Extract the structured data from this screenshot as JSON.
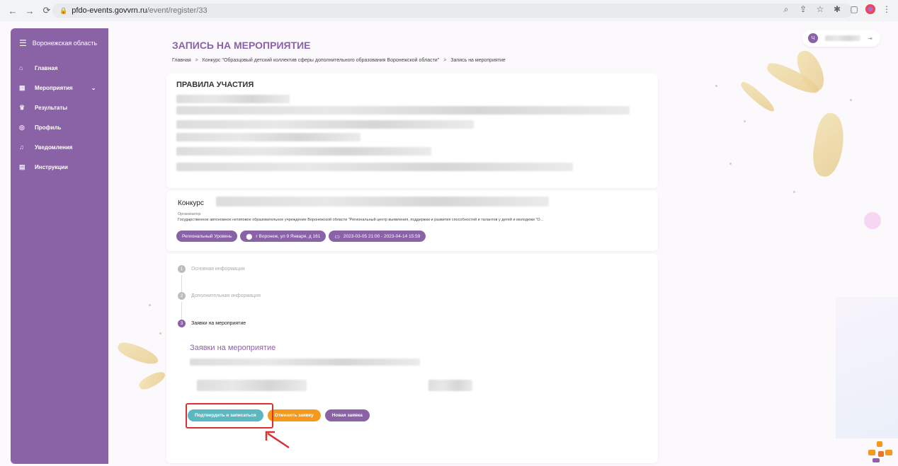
{
  "browser": {
    "url_host": "pfdo-events.govvrn.ru",
    "url_path": "/event/register/33"
  },
  "sidebar": {
    "region": "Воронежская область",
    "items": [
      {
        "label": "Главная",
        "icon": "home-icon"
      },
      {
        "label": "Мероприятия",
        "icon": "calendar-icon"
      },
      {
        "label": "Результаты",
        "icon": "trophy-icon"
      },
      {
        "label": "Профиль",
        "icon": "user-icon"
      },
      {
        "label": "Уведомления",
        "icon": "bell-icon"
      },
      {
        "label": "Инструкции",
        "icon": "book-icon"
      }
    ]
  },
  "header": {
    "title": "ЗАПИСЬ НА МЕРОПРИЯТИЕ",
    "user_initial": "Ч"
  },
  "breadcrumb": {
    "home": "Главная",
    "sep": ">",
    "contest": "Конкурс \"Образцовый детский коллектив сферы дополнительного образования Воронежской области\"",
    "current": "Запись на мероприятие"
  },
  "rules": {
    "title": "ПРАВИЛА УЧАСТИЯ"
  },
  "contest": {
    "prefix": "Конкурс",
    "organizer_label": "Организатор",
    "organizer": "Государственное автономное нетиповое образовательное учреждение Воронежской области \"Региональный центр выявления, поддержки и развития способностей и талантов у детей и молодежи \"О...",
    "level": "Региональный Уровень",
    "address": "г Воронеж, ул 9 Января, д 161",
    "dates": "2023-03-05 21:00 - 2023-04-14 15:59"
  },
  "steps": [
    {
      "num": "1",
      "label": "Основная информация"
    },
    {
      "num": "2",
      "label": "Дополнительная информация"
    },
    {
      "num": "3",
      "label": "Заявки на мероприятие"
    }
  ],
  "applications": {
    "title": "Заявки на мероприятие",
    "confirm": "Подтвердить и записаться",
    "cancel": "Отменить заявку",
    "new": "Новая заявка"
  },
  "colors": {
    "primary": "#8a63a7",
    "confirm": "#5bb8c2",
    "cancel": "#f39a1e",
    "highlight": "#d93131"
  }
}
